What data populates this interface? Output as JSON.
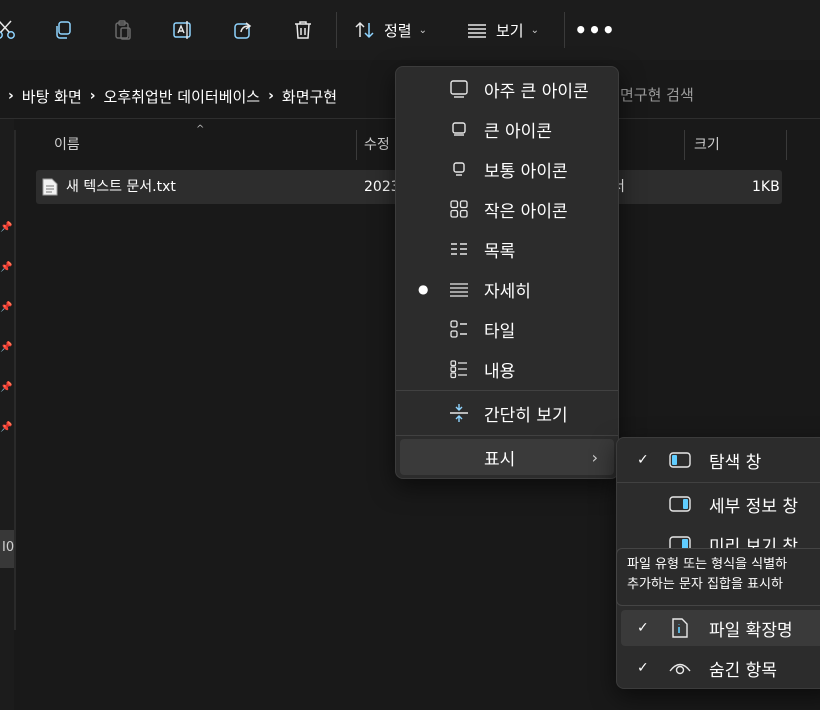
{
  "toolbar": {
    "sort_label": "정렬",
    "view_label": "보기"
  },
  "address": {
    "breadcrumb": [
      "바탕 화면",
      "오후취업반 데이터베이스",
      "화면구현"
    ],
    "search_placeholder": "면구현 검색"
  },
  "nav": {
    "selected_fragment": "I0"
  },
  "list": {
    "headers": {
      "name": "이름",
      "modified": "수정",
      "size": "크기"
    },
    "files": [
      {
        "name": "새 텍스트 문서.txt",
        "modified": "2023",
        "type": "서",
        "size": "1KB"
      }
    ]
  },
  "view_menu": {
    "items": [
      {
        "label": "아주 큰 아이콘",
        "icon": "extra-large-icons-icon"
      },
      {
        "label": "큰 아이콘",
        "icon": "large-icons-icon"
      },
      {
        "label": "보통 아이콘",
        "icon": "medium-icons-icon"
      },
      {
        "label": "작은 아이콘",
        "icon": "small-icons-icon"
      },
      {
        "label": "목록",
        "icon": "list-icon"
      },
      {
        "label": "자세히",
        "icon": "details-icon",
        "selected": true
      },
      {
        "label": "타일",
        "icon": "tiles-icon"
      },
      {
        "label": "내용",
        "icon": "content-icon"
      },
      {
        "label": "간단히 보기",
        "icon": "compact-view-icon"
      },
      {
        "label": "표시",
        "icon": "",
        "submenu": true
      }
    ]
  },
  "show_menu": {
    "items": [
      {
        "label": "탐색 창",
        "icon": "navigation-pane-icon",
        "checked": true
      },
      {
        "label": "세부 정보 창",
        "icon": "details-pane-icon",
        "checked": false
      },
      {
        "label": "미리 보기 창",
        "icon": "preview-pane-icon",
        "checked": false
      },
      {
        "label": "파일 확장명",
        "icon": "file-extension-icon",
        "checked": true
      },
      {
        "label": "숨긴 항목",
        "icon": "hidden-items-icon",
        "checked": true
      }
    ],
    "tooltip": [
      "파일 유형 또는 형식을 식별하",
      "추가하는 문자 집합을 표시하"
    ]
  },
  "colors": {
    "background": "#191919",
    "menu_bg": "#2c2c2c",
    "accent_icon": "#60cdff"
  }
}
